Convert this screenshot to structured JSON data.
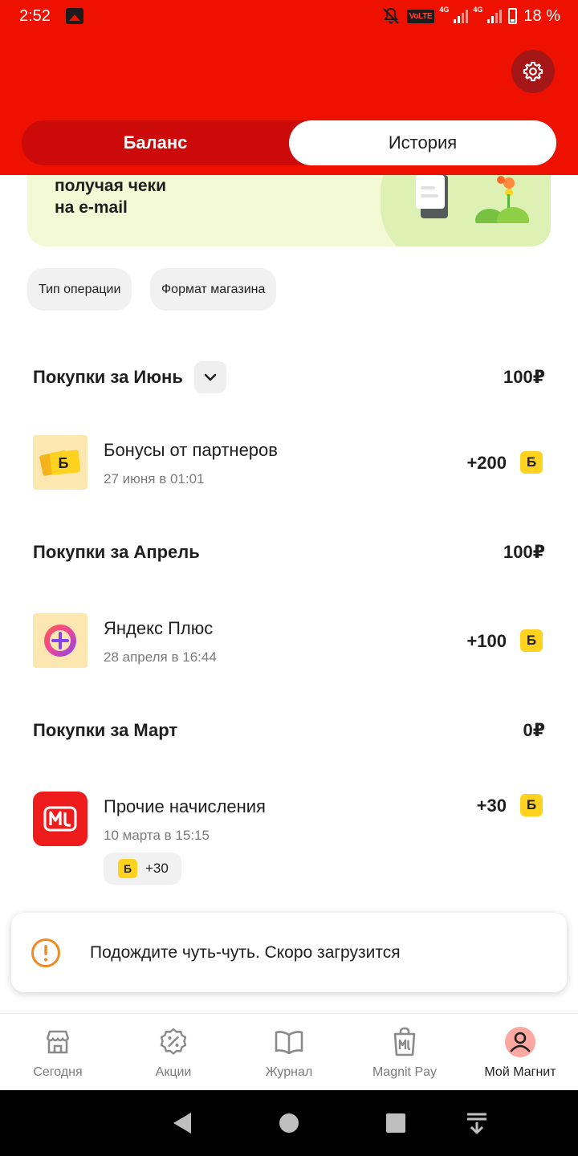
{
  "status_bar": {
    "time": "2:52",
    "volte": "VoLTE",
    "network_1": "4G",
    "network_2": "4G",
    "battery": "18 %"
  },
  "header": {
    "tabs": [
      {
        "label": "Баланс",
        "selected": false
      },
      {
        "label": "История",
        "selected": true
      }
    ]
  },
  "promo": {
    "line1": "получая чеки",
    "line2": "на e-mail"
  },
  "filters": [
    {
      "label": "Тип операции"
    },
    {
      "label": "Формат магазина"
    }
  ],
  "sections": [
    {
      "title": "Покупки за Июнь",
      "total": "100₽",
      "operations": [
        {
          "title": "Бонусы от партнеров",
          "date": "27 июня в 01:01",
          "amount": "+200",
          "badge": "Б",
          "icon": "partner-bonus-icon"
        }
      ]
    },
    {
      "title": "Покупки за Апрель",
      "total": "100₽",
      "operations": [
        {
          "title": "Яндекс Плюс",
          "date": "28 апреля в 16:44",
          "amount": "+100",
          "badge": "Б",
          "icon": "yandex-plus-icon"
        }
      ]
    },
    {
      "title": "Покупки за Март",
      "total": "0₽",
      "operations": [
        {
          "title": "Прочие начисления",
          "date": "10 марта в 15:15",
          "amount": "+30",
          "badge": "Б",
          "icon": "magnit-logo-icon",
          "chip_badge": "Б",
          "chip_amount": "+30"
        }
      ]
    }
  ],
  "toast": {
    "text": "Подождите чуть-чуть. Скоро загрузится"
  },
  "bottom_nav": [
    {
      "label": "Сегодня",
      "icon": "store-icon",
      "active": false
    },
    {
      "label": "Акции",
      "icon": "discount-icon",
      "active": false
    },
    {
      "label": "Журнал",
      "icon": "book-icon",
      "active": false
    },
    {
      "label": "Magnit Pay",
      "icon": "magnit-pay-icon",
      "active": false
    },
    {
      "label": "Мой Магнит",
      "icon": "profile-icon",
      "active": true
    }
  ],
  "colors": {
    "brand_red": "#ee1100",
    "bonus_yellow": "#ffd21f",
    "promo_green": "#f2f9d4",
    "toast_orange": "#f08a24"
  }
}
